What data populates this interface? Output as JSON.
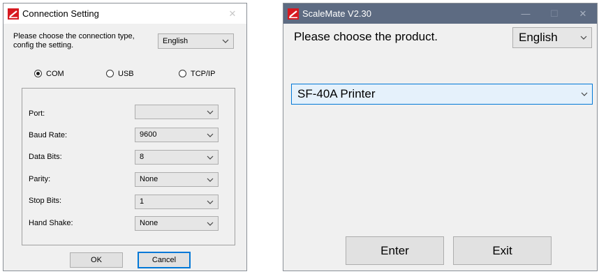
{
  "connection_dialog": {
    "title": "Connection Setting",
    "close_glyph": "✕",
    "prompt": "Please choose the connection type, config the setting.",
    "language": "English",
    "connection_types": [
      {
        "label": "COM",
        "selected": true
      },
      {
        "label": "USB",
        "selected": false
      },
      {
        "label": "TCP/IP",
        "selected": false
      }
    ],
    "fields": [
      {
        "label": "Port:",
        "value": ""
      },
      {
        "label": "Baud Rate:",
        "value": "9600"
      },
      {
        "label": "Data Bits:",
        "value": "8"
      },
      {
        "label": "Parity:",
        "value": "None"
      },
      {
        "label": "Stop Bits:",
        "value": "1"
      },
      {
        "label": "Hand Shake:",
        "value": "None"
      }
    ],
    "ok_label": "OK",
    "cancel_label": "Cancel"
  },
  "scalemate": {
    "title": "ScaleMate  V2.30",
    "minimize_glyph": "—",
    "maximize_glyph": "☐",
    "close_glyph": "✕",
    "prompt": "Please choose the product.",
    "language": "English",
    "product": "SF-40A Printer",
    "enter_label": "Enter",
    "exit_label": "Exit"
  },
  "icons": {
    "app_logo": "ohaus-logo-icon",
    "dropdown": "chevron-down-icon"
  },
  "colors": {
    "titlebar_active": "#5d6b82",
    "focus_border": "#0078d7",
    "selected_item_bg": "#e5f1fb",
    "logo_red": "#d71920"
  }
}
